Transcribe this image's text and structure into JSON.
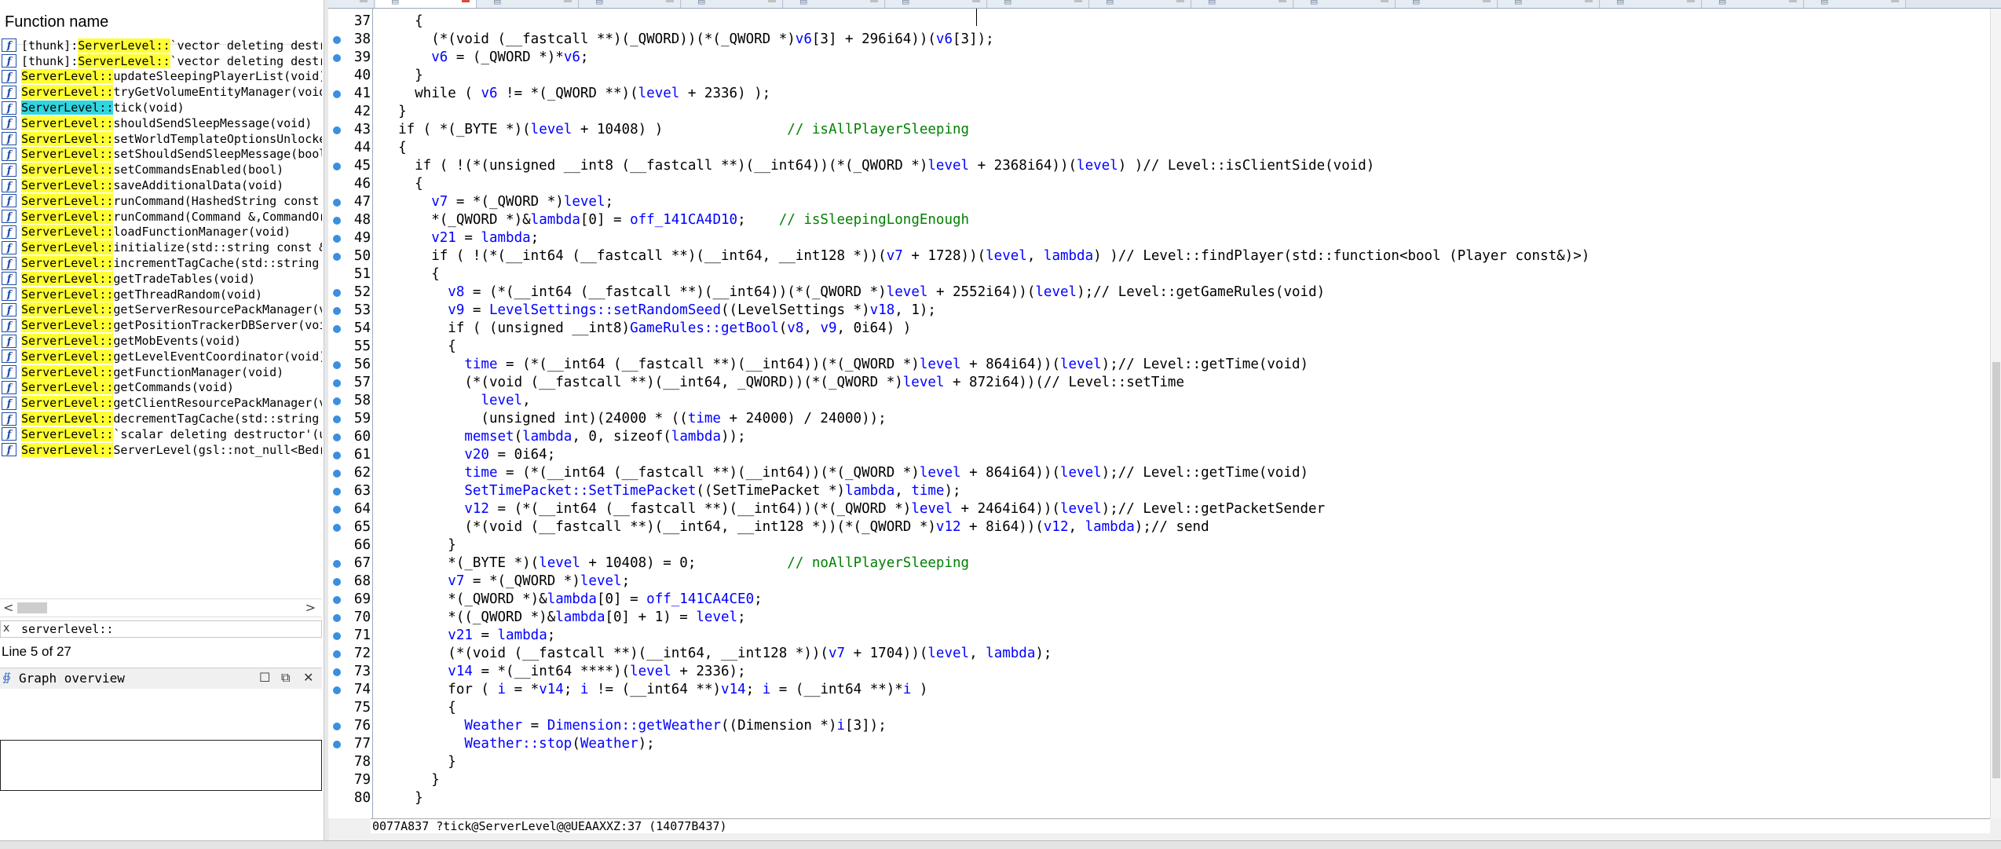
{
  "function_panel": {
    "header": "Function name",
    "icon_glyph": "f",
    "items": [
      {
        "class": "[thunk]:ServerLevel::",
        "name": "`vector deleting destructor'(uint)",
        "selected": false
      },
      {
        "class": "[thunk]:ServerLevel::",
        "name": "`vector deleting destructor'(uint)",
        "selected": false
      },
      {
        "class": "ServerLevel::",
        "name": "updateSleepingPlayerList(void)",
        "selected": false
      },
      {
        "class": "ServerLevel::",
        "name": "tryGetVolumeEntityManager(void)",
        "selected": false
      },
      {
        "class": "ServerLevel::",
        "name": "tick(void)",
        "selected": true
      },
      {
        "class": "ServerLevel::",
        "name": "shouldSendSleepMessage(void)",
        "selected": false
      },
      {
        "class": "ServerLevel::",
        "name": "setWorldTemplateOptionsUnlocked(void)",
        "selected": false
      },
      {
        "class": "ServerLevel::",
        "name": "setShouldSendSleepMessage(bool)",
        "selected": false
      },
      {
        "class": "ServerLevel::",
        "name": "setCommandsEnabled(bool)",
        "selected": false
      },
      {
        "class": "ServerLevel::",
        "name": "saveAdditionalData(void)",
        "selected": false
      },
      {
        "class": "ServerLevel::",
        "name": "runCommand(HashedString const &",
        "selected": false
      },
      {
        "class": "ServerLevel::",
        "name": "runCommand(Command &,CommandOrigin",
        "selected": false
      },
      {
        "class": "ServerLevel::",
        "name": "loadFunctionManager(void)",
        "selected": false
      },
      {
        "class": "ServerLevel::",
        "name": "initialize(std::string const &",
        "selected": false
      },
      {
        "class": "ServerLevel::",
        "name": "incrementTagCache(std::string",
        "selected": false
      },
      {
        "class": "ServerLevel::",
        "name": "getTradeTables(void)",
        "selected": false
      },
      {
        "class": "ServerLevel::",
        "name": "getThreadRandom(void)",
        "selected": false
      },
      {
        "class": "ServerLevel::",
        "name": "getServerResourcePackManager(void)",
        "selected": false
      },
      {
        "class": "ServerLevel::",
        "name": "getPositionTrackerDBServer(void)",
        "selected": false
      },
      {
        "class": "ServerLevel::",
        "name": "getMobEvents(void)",
        "selected": false
      },
      {
        "class": "ServerLevel::",
        "name": "getLevelEventCoordinator(void)",
        "selected": false
      },
      {
        "class": "ServerLevel::",
        "name": "getFunctionManager(void)",
        "selected": false
      },
      {
        "class": "ServerLevel::",
        "name": "getCommands(void)",
        "selected": false
      },
      {
        "class": "ServerLevel::",
        "name": "getClientResourcePackManager(void)",
        "selected": false
      },
      {
        "class": "ServerLevel::",
        "name": "decrementTagCache(std::string",
        "selected": false
      },
      {
        "class": "ServerLevel::",
        "name": "`scalar deleting destructor'(uint)",
        "selected": false
      },
      {
        "class": "ServerLevel::",
        "name": "ServerLevel(gsl::not_null<Bedrock",
        "selected": false
      }
    ],
    "scroll_left": "<",
    "scroll_right": ">",
    "filter_clear_icon": "x",
    "filter_value": "serverlevel::",
    "status": "Line 5 of 27"
  },
  "graph_overview": {
    "title": "Graph overview",
    "buttons": [
      "☐",
      "⧉",
      "✕"
    ]
  },
  "code_view": {
    "status": "0077A837 ?tick@ServerLevel@@UEAAXXZ:37 (14077B437)",
    "lines": [
      {
        "n": "37",
        "segs": [
          [
            "k",
            "    {"
          ]
        ]
      },
      {
        "n": "38",
        "segs": [
          [
            "k",
            "      (*(void (__fastcall **)(_QWORD))(*(_QWORD *)"
          ],
          [
            "v",
            "v6"
          ],
          [
            "k",
            "[3] + 296i64))("
          ],
          [
            "v",
            "v6"
          ],
          [
            "k",
            "[3]);"
          ]
        ]
      },
      {
        "n": "39",
        "segs": [
          [
            "k",
            "      "
          ],
          [
            "v",
            "v6"
          ],
          [
            "k",
            " = (_QWORD *)*"
          ],
          [
            "v",
            "v6"
          ],
          [
            "k",
            ";"
          ]
        ]
      },
      {
        "n": "40",
        "segs": [
          [
            "k",
            "    }"
          ]
        ]
      },
      {
        "n": "41",
        "segs": [
          [
            "k",
            "    while ( "
          ],
          [
            "v",
            "v6"
          ],
          [
            "k",
            " != *(_QWORD **)("
          ],
          [
            "v",
            "level"
          ],
          [
            "k",
            " + 2336) );"
          ]
        ]
      },
      {
        "n": "42",
        "segs": [
          [
            "k",
            "  }"
          ]
        ]
      },
      {
        "n": "43",
        "segs": [
          [
            "k",
            "  if ( *(_BYTE *)("
          ],
          [
            "v",
            "level"
          ],
          [
            "k",
            " + 10408) )               "
          ],
          [
            "c",
            "// isAllPlayerSleeping"
          ]
        ]
      },
      {
        "n": "44",
        "segs": [
          [
            "k",
            "  {"
          ]
        ]
      },
      {
        "n": "45",
        "segs": [
          [
            "k",
            "    if ( !(*(unsigned __int8 (__fastcall **)(__int64))(*(_QWORD *)"
          ],
          [
            "v",
            "level"
          ],
          [
            "k",
            " + 2368i64))("
          ],
          [
            "v",
            "level"
          ],
          [
            "k",
            ") )// Level::isClientSide(void)"
          ]
        ]
      },
      {
        "n": "46",
        "segs": [
          [
            "k",
            "    {"
          ]
        ]
      },
      {
        "n": "47",
        "segs": [
          [
            "k",
            "      "
          ],
          [
            "v",
            "v7"
          ],
          [
            "k",
            " = *(_QWORD *)"
          ],
          [
            "v",
            "level"
          ],
          [
            "k",
            ";"
          ]
        ]
      },
      {
        "n": "48",
        "segs": [
          [
            "k",
            "      *(_QWORD *)&"
          ],
          [
            "v",
            "lambda"
          ],
          [
            "k",
            "[0] = "
          ],
          [
            "v",
            "off_141CA4D10"
          ],
          [
            "k",
            ";    "
          ],
          [
            "c",
            "// isSleepingLongEnough"
          ]
        ]
      },
      {
        "n": "49",
        "segs": [
          [
            "k",
            "      "
          ],
          [
            "v",
            "v21"
          ],
          [
            "k",
            " = "
          ],
          [
            "v",
            "lambda"
          ],
          [
            "k",
            ";"
          ]
        ]
      },
      {
        "n": "50",
        "segs": [
          [
            "k",
            "      if ( !(*(__int64 (__fastcall **)(__int64, __int128 *))("
          ],
          [
            "v",
            "v7"
          ],
          [
            "k",
            " + 1728))("
          ],
          [
            "v",
            "level"
          ],
          [
            "k",
            ", "
          ],
          [
            "v",
            "lambda"
          ],
          [
            "k",
            ") )// Level::findPlayer(std::function<bool (Player const&)>)"
          ]
        ]
      },
      {
        "n": "51",
        "segs": [
          [
            "k",
            "      {"
          ]
        ]
      },
      {
        "n": "52",
        "segs": [
          [
            "k",
            "        "
          ],
          [
            "v",
            "v8"
          ],
          [
            "k",
            " = (*(__int64 (__fastcall **)(__int64))(*(_QWORD *)"
          ],
          [
            "v",
            "level"
          ],
          [
            "k",
            " + 2552i64))("
          ],
          [
            "v",
            "level"
          ],
          [
            "k",
            ");// Level::getGameRules(void)"
          ]
        ]
      },
      {
        "n": "53",
        "segs": [
          [
            "k",
            "        "
          ],
          [
            "v",
            "v9"
          ],
          [
            "k",
            " = "
          ],
          [
            "v",
            "LevelSettings::setRandomSeed"
          ],
          [
            "k",
            "((LevelSettings *)"
          ],
          [
            "v",
            "v18"
          ],
          [
            "k",
            ", 1);"
          ]
        ]
      },
      {
        "n": "54",
        "segs": [
          [
            "k",
            "        if ( (unsigned __int8)"
          ],
          [
            "v",
            "GameRules::getBool"
          ],
          [
            "k",
            "("
          ],
          [
            "v",
            "v8"
          ],
          [
            "k",
            ", "
          ],
          [
            "v",
            "v9"
          ],
          [
            "k",
            ", 0i64) )"
          ]
        ]
      },
      {
        "n": "55",
        "segs": [
          [
            "k",
            "        {"
          ]
        ]
      },
      {
        "n": "56",
        "segs": [
          [
            "k",
            "          "
          ],
          [
            "v",
            "time"
          ],
          [
            "k",
            " = (*(__int64 (__fastcall **)(__int64))(*(_QWORD *)"
          ],
          [
            "v",
            "level"
          ],
          [
            "k",
            " + 864i64))("
          ],
          [
            "v",
            "level"
          ],
          [
            "k",
            ");// Level::getTime(void)"
          ]
        ]
      },
      {
        "n": "57",
        "segs": [
          [
            "k",
            "          (*(void (__fastcall **)(__int64, _QWORD))(*(_QWORD *)"
          ],
          [
            "v",
            "level"
          ],
          [
            "k",
            " + 872i64))(// Level::setTime"
          ]
        ]
      },
      {
        "n": "58",
        "segs": [
          [
            "k",
            "            "
          ],
          [
            "v",
            "level"
          ],
          [
            "k",
            ","
          ]
        ]
      },
      {
        "n": "59",
        "segs": [
          [
            "k",
            "            (unsigned int)(24000 * (("
          ],
          [
            "v",
            "time"
          ],
          [
            "k",
            " + 24000) / 24000));"
          ]
        ]
      },
      {
        "n": "60",
        "segs": [
          [
            "k",
            "          "
          ],
          [
            "v",
            "memset"
          ],
          [
            "k",
            "("
          ],
          [
            "v",
            "lambda"
          ],
          [
            "k",
            ", 0, sizeof("
          ],
          [
            "v",
            "lambda"
          ],
          [
            "k",
            "));"
          ]
        ]
      },
      {
        "n": "61",
        "segs": [
          [
            "k",
            "          "
          ],
          [
            "v",
            "v20"
          ],
          [
            "k",
            " = 0i64;"
          ]
        ]
      },
      {
        "n": "62",
        "segs": [
          [
            "k",
            "          "
          ],
          [
            "v",
            "time"
          ],
          [
            "k",
            " = (*(__int64 (__fastcall **)(__int64))(*(_QWORD *)"
          ],
          [
            "v",
            "level"
          ],
          [
            "k",
            " + 864i64))("
          ],
          [
            "v",
            "level"
          ],
          [
            "k",
            ");// Level::getTime(void)"
          ]
        ]
      },
      {
        "n": "63",
        "segs": [
          [
            "k",
            "          "
          ],
          [
            "v",
            "SetTimePacket::SetTimePacket"
          ],
          [
            "k",
            "((SetTimePacket *)"
          ],
          [
            "v",
            "lambda"
          ],
          [
            "k",
            ", "
          ],
          [
            "v",
            "time"
          ],
          [
            "k",
            ");"
          ]
        ]
      },
      {
        "n": "64",
        "segs": [
          [
            "k",
            "          "
          ],
          [
            "v",
            "v12"
          ],
          [
            "k",
            " = (*(__int64 (__fastcall **)(__int64))(*(_QWORD *)"
          ],
          [
            "v",
            "level"
          ],
          [
            "k",
            " + 2464i64))("
          ],
          [
            "v",
            "level"
          ],
          [
            "k",
            ");// Level::getPacketSender"
          ]
        ]
      },
      {
        "n": "65",
        "segs": [
          [
            "k",
            "          (*(void (__fastcall **)(__int64, __int128 *))(*(_QWORD *)"
          ],
          [
            "v",
            "v12"
          ],
          [
            "k",
            " + 8i64))("
          ],
          [
            "v",
            "v12"
          ],
          [
            "k",
            ", "
          ],
          [
            "v",
            "lambda"
          ],
          [
            "k",
            ");// send"
          ]
        ]
      },
      {
        "n": "66",
        "segs": [
          [
            "k",
            "        }"
          ]
        ]
      },
      {
        "n": "67",
        "segs": [
          [
            "k",
            "        *(_BYTE *)("
          ],
          [
            "v",
            "level"
          ],
          [
            "k",
            " + 10408) = 0;           "
          ],
          [
            "c",
            "// noAllPlayerSleeping"
          ]
        ]
      },
      {
        "n": "68",
        "segs": [
          [
            "k",
            "        "
          ],
          [
            "v",
            "v7"
          ],
          [
            "k",
            " = *(_QWORD *)"
          ],
          [
            "v",
            "level"
          ],
          [
            "k",
            ";"
          ]
        ]
      },
      {
        "n": "69",
        "segs": [
          [
            "k",
            "        *(_QWORD *)&"
          ],
          [
            "v",
            "lambda"
          ],
          [
            "k",
            "[0] = "
          ],
          [
            "v",
            "off_141CA4CE0"
          ],
          [
            "k",
            ";"
          ]
        ]
      },
      {
        "n": "70",
        "segs": [
          [
            "k",
            "        *((_QWORD *)&"
          ],
          [
            "v",
            "lambda"
          ],
          [
            "k",
            "[0] + 1) = "
          ],
          [
            "v",
            "level"
          ],
          [
            "k",
            ";"
          ]
        ]
      },
      {
        "n": "71",
        "segs": [
          [
            "k",
            "        "
          ],
          [
            "v",
            "v21"
          ],
          [
            "k",
            " = "
          ],
          [
            "v",
            "lambda"
          ],
          [
            "k",
            ";"
          ]
        ]
      },
      {
        "n": "72",
        "segs": [
          [
            "k",
            "        (*(void (__fastcall **)(__int64, __int128 *))("
          ],
          [
            "v",
            "v7"
          ],
          [
            "k",
            " + 1704))("
          ],
          [
            "v",
            "level"
          ],
          [
            "k",
            ", "
          ],
          [
            "v",
            "lambda"
          ],
          [
            "k",
            ");"
          ]
        ]
      },
      {
        "n": "73",
        "segs": [
          [
            "k",
            "        "
          ],
          [
            "v",
            "v14"
          ],
          [
            "k",
            " = *(__int64 ****)("
          ],
          [
            "v",
            "level"
          ],
          [
            "k",
            " + 2336);"
          ]
        ]
      },
      {
        "n": "74",
        "segs": [
          [
            "k",
            "        for ( "
          ],
          [
            "v",
            "i"
          ],
          [
            "k",
            " = *"
          ],
          [
            "v",
            "v14"
          ],
          [
            "k",
            "; "
          ],
          [
            "v",
            "i"
          ],
          [
            "k",
            " != (__int64 **)"
          ],
          [
            "v",
            "v14"
          ],
          [
            "k",
            "; "
          ],
          [
            "v",
            "i"
          ],
          [
            "k",
            " = (__int64 **)*"
          ],
          [
            "v",
            "i"
          ],
          [
            "k",
            " )"
          ]
        ]
      },
      {
        "n": "75",
        "segs": [
          [
            "k",
            "        {"
          ]
        ]
      },
      {
        "n": "76",
        "segs": [
          [
            "k",
            "          "
          ],
          [
            "v",
            "Weather"
          ],
          [
            "k",
            " = "
          ],
          [
            "v",
            "Dimension::getWeather"
          ],
          [
            "k",
            "((Dimension *)"
          ],
          [
            "v",
            "i"
          ],
          [
            "k",
            "[3]);"
          ]
        ]
      },
      {
        "n": "77",
        "segs": [
          [
            "k",
            "          "
          ],
          [
            "v",
            "Weather::stop"
          ],
          [
            "k",
            "("
          ],
          [
            "v",
            "Weather"
          ],
          [
            "k",
            ");"
          ]
        ]
      },
      {
        "n": "78",
        "segs": [
          [
            "k",
            "        }"
          ]
        ]
      },
      {
        "n": "79",
        "segs": [
          [
            "k",
            "      }"
          ]
        ]
      },
      {
        "n": "80",
        "segs": [
          [
            "k",
            "    }"
          ]
        ]
      }
    ]
  }
}
